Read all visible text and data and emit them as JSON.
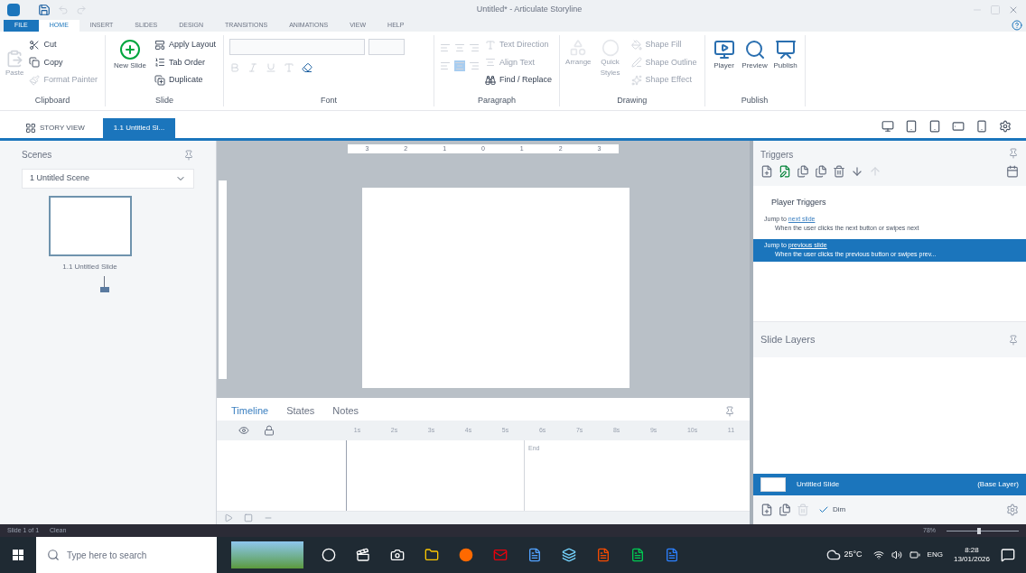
{
  "window": {
    "title": "Untitled* - Articulate Storyline"
  },
  "ribbon_tabs": [
    {
      "label": "FILE",
      "kind": "file",
      "selected": false
    },
    {
      "label": "HOME",
      "kind": "tab",
      "selected": true
    },
    {
      "label": "INSERT",
      "kind": "tab",
      "selected": false
    },
    {
      "label": "SLIDES",
      "kind": "tab",
      "selected": false
    },
    {
      "label": "DESIGN",
      "kind": "tab",
      "selected": false
    },
    {
      "label": "TRANSITIONS",
      "kind": "tab",
      "selected": false
    },
    {
      "label": "ANIMATIONS",
      "kind": "tab",
      "selected": false
    },
    {
      "label": "VIEW",
      "kind": "tab",
      "selected": false
    },
    {
      "label": "HELP",
      "kind": "tab",
      "selected": false
    }
  ],
  "ribbon": {
    "clipboard": {
      "label": "Clipboard",
      "paste": "Paste",
      "items": [
        {
          "label": "Cut",
          "disabled": false
        },
        {
          "label": "Copy",
          "disabled": false
        },
        {
          "label": "Format Painter",
          "disabled": true
        }
      ]
    },
    "slide": {
      "label": "Slide",
      "new_slide": "New Slide",
      "items": [
        {
          "label": "Apply Layout",
          "disabled": false
        },
        {
          "label": "Tab Order",
          "disabled": false
        },
        {
          "label": "Duplicate",
          "disabled": false
        }
      ]
    },
    "font": {
      "label": "Font"
    },
    "paragraph": {
      "label": "Paragraph",
      "items": [
        {
          "label": "Text Direction",
          "disabled": true
        },
        {
          "label": "Align Text",
          "disabled": true
        },
        {
          "label": "Find / Replace",
          "disabled": false
        }
      ]
    },
    "drawing": {
      "label": "Drawing",
      "arrange": "Arrange",
      "quick_styles": "Quick Styles",
      "items": [
        {
          "label": "Shape Fill",
          "disabled": true
        },
        {
          "label": "Shape Outline",
          "disabled": true
        },
        {
          "label": "Shape Effect",
          "disabled": true
        }
      ]
    },
    "publish": {
      "label": "Publish",
      "buttons": [
        "Player",
        "Preview",
        "Publish"
      ]
    }
  },
  "view_tabs": [
    {
      "label": "STORY VIEW",
      "selected": false
    },
    {
      "label": "1.1 Untitled Sl...",
      "selected": true
    }
  ],
  "scenes": {
    "title": "Scenes",
    "scene": "1 Untitled Scene",
    "slides": [
      {
        "label": "1.1 Untitled Slide",
        "selected": true
      }
    ]
  },
  "ruler": {
    "ticks": [
      "3",
      "2",
      "1",
      "0",
      "1",
      "2",
      "3"
    ]
  },
  "timeline": {
    "tabs": [
      {
        "label": "Timeline",
        "selected": true
      },
      {
        "label": "States",
        "selected": false
      },
      {
        "label": "Notes",
        "selected": false
      }
    ],
    "ticks": [
      "1s",
      "2s",
      "3s",
      "4s",
      "5s",
      "6s",
      "7s",
      "8s",
      "9s",
      "10s",
      "11"
    ],
    "end_label": "End"
  },
  "triggers": {
    "title": "Triggers",
    "group": "Player Triggers",
    "items": [
      {
        "action": "Jump to ",
        "target": "next slide",
        "condition": "When the user clicks the next button or swipes next",
        "selected": false
      },
      {
        "action": "Jump to ",
        "target": "previous slide",
        "condition": "When the user clicks the previous button or swipes prev...",
        "selected": true
      }
    ]
  },
  "slide_layers": {
    "title": "Slide Layers",
    "layers": [
      {
        "name": "Untitled Slide",
        "badge": "(Base Layer)",
        "selected": true
      }
    ],
    "dim": {
      "label": "Dim",
      "checked": true
    }
  },
  "status_bar": {
    "slide": "Slide 1 of 1",
    "theme": "Clean",
    "zoom": "78%",
    "level": 0.45
  },
  "taskbar": {
    "search_placeholder": "Type here to search",
    "weather": "25°C",
    "language": "ENG",
    "time": "8:28",
    "date": "13/01/2026"
  }
}
